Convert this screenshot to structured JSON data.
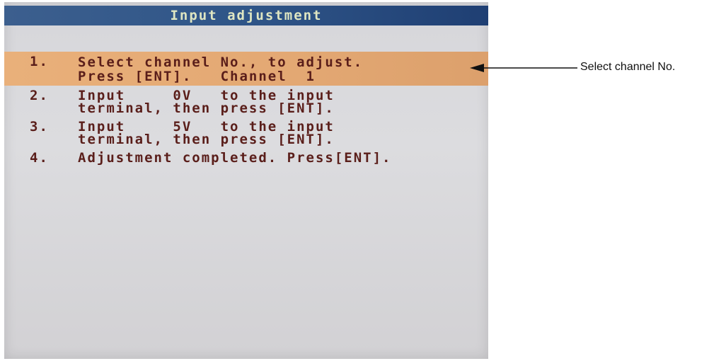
{
  "title": "Input adjustment",
  "steps": [
    {
      "num": "1.",
      "line1": "Select channel No., to adjust.",
      "line2": "Press [ENT].   Channel  1"
    },
    {
      "num": "2.",
      "line1": "Input     0V   to the input",
      "line2": "terminal, then press [ENT]."
    },
    {
      "num": "3.",
      "line1": "Input     5V   to the input",
      "line2": "terminal, then press [ENT]."
    },
    {
      "num": "4.",
      "line1": "Adjustment completed. Press[ENT].",
      "line2": ""
    }
  ],
  "annotation": "Select channel No.",
  "colors": {
    "title_bg": "#2f5588",
    "highlight_bg": "#e3a873",
    "text": "#5a1e1a",
    "screen_bg": "#d8d8db"
  }
}
